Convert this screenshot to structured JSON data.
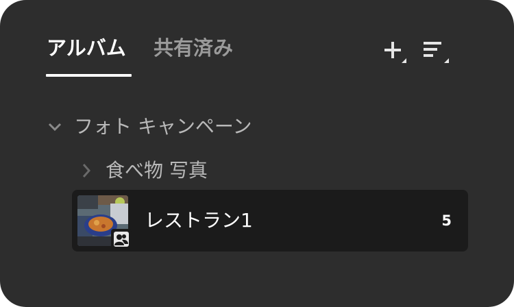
{
  "tabs": {
    "albums_label": "アルバム",
    "shared_label": "共有済み",
    "active": "albums"
  },
  "toolbar": {
    "add_icon": "plus-icon",
    "sort_icon": "sort-lines-icon"
  },
  "tree": {
    "folder": {
      "label": "フォト キャンペーン",
      "state": "expanded"
    },
    "subfolder": {
      "label": "食べ物 写真",
      "state": "collapsed"
    },
    "album": {
      "name": "レストラン1",
      "count": "5",
      "shared": true,
      "selected": true
    }
  },
  "colors": {
    "panel_bg": "#2d2d2d",
    "selected_row_bg": "#1b1b1b",
    "active_text": "#ffffff",
    "inactive_text": "#9a9a9a",
    "tree_text": "#b9b9b9"
  }
}
